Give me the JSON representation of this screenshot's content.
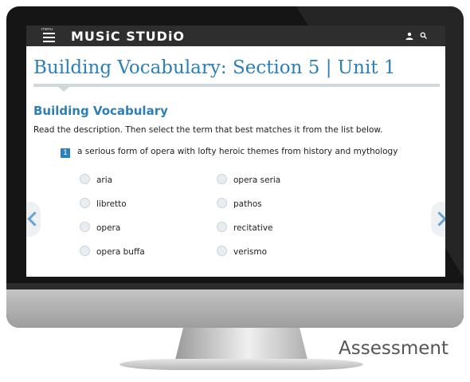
{
  "app": {
    "menu_label": "menu",
    "brand": "MUSiC STUDiO"
  },
  "page": {
    "title": "Building Vocabulary: Section 5 | Unit 1",
    "section_heading": "Building Vocabulary",
    "instructions": "Read the description. Then select the term that best matches it from the list below."
  },
  "question": {
    "number": "1",
    "text": "a serious form of opera with lofty heroic themes from history and mythology"
  },
  "options": {
    "left": [
      "aria",
      "libretto",
      "opera",
      "opera buffa"
    ],
    "right": [
      "opera seria",
      "pathos",
      "recitative",
      "verismo"
    ]
  },
  "caption": "Assessment",
  "colors": {
    "accent": "#2c7fb8",
    "topbar": "#2e2e2e"
  },
  "icons": {
    "menu": "menu-icon",
    "user": "user-icon",
    "search": "search-icon",
    "prev": "chevron-left-icon",
    "next": "chevron-right-icon"
  }
}
